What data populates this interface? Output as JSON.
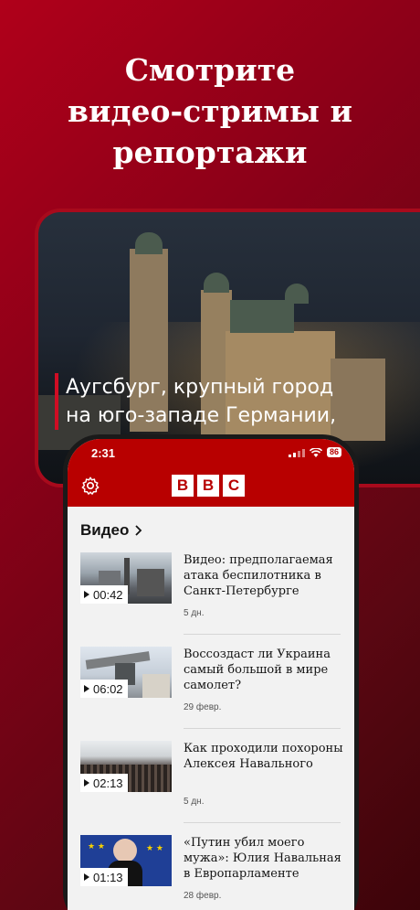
{
  "promo": {
    "headline_lines": [
      "Смотрите",
      "видео-стримы и",
      "репортажи"
    ]
  },
  "background_video": {
    "caption_lines": [
      "Аугсбург, крупный город",
      "на юго-западе Германии,"
    ]
  },
  "status_bar": {
    "time": "2:31",
    "battery": "86"
  },
  "app_bar": {
    "logo_letters": [
      "B",
      "B",
      "C"
    ],
    "settings_icon": "gear-icon"
  },
  "section": {
    "title": "Видео"
  },
  "videos": [
    {
      "title": "Видео: предполагаемая атака беспилотника в Санкт-Петербурге",
      "duration": "00:42",
      "date": "5 дн."
    },
    {
      "title": "Воссоздаст ли Украина самый большой в мире самолет?",
      "duration": "06:02",
      "date": "29 февр."
    },
    {
      "title": "Как проходили похороны Алексея Навального",
      "duration": "02:13",
      "date": "5 дн."
    },
    {
      "title": "«Путин убил моего мужа»: Юлия Навальная в Европарламенте",
      "duration": "01:13",
      "date": "28 февр."
    }
  ],
  "colors": {
    "brand_red": "#b80000",
    "accent_red": "#d00d24"
  }
}
